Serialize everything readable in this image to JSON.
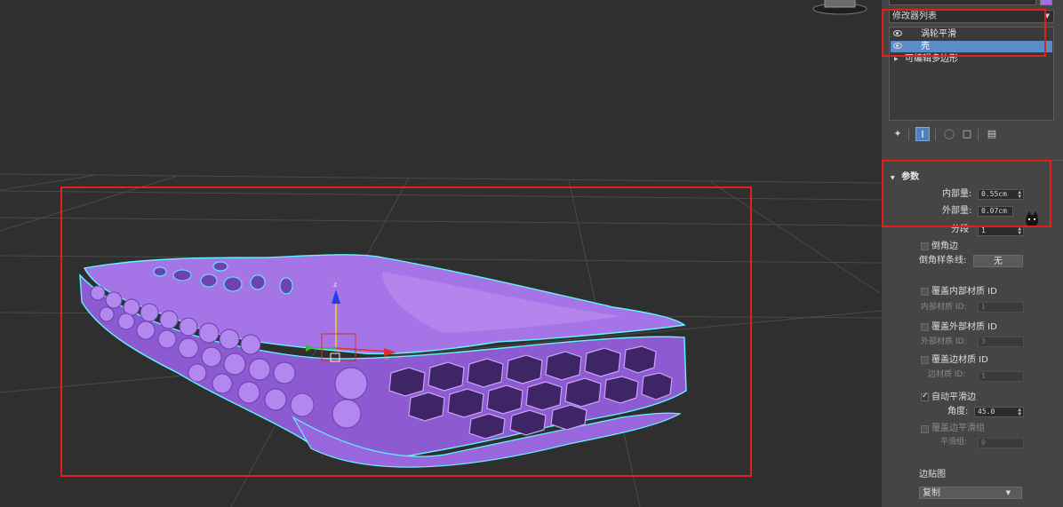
{
  "modifier_list": {
    "label": "修改器列表"
  },
  "stack": {
    "items": [
      {
        "label": "涡轮平滑",
        "visible": true
      },
      {
        "label": "壳",
        "visible": true,
        "selected": true
      },
      {
        "label": "可编辑多边形",
        "visible": false
      }
    ]
  },
  "toolbar": {
    "pin": "pin-stack-icon",
    "show_end_result": "show-end-result-icon",
    "make_unique": "make-unique-icon",
    "remove": "remove-modifier-icon",
    "configure": "configure-sets-icon"
  },
  "params": {
    "title": "参数",
    "inner_amount": {
      "label": "内部量:",
      "value": "0.55cm"
    },
    "outer_amount": {
      "label": "外部量:",
      "value": "0.07cm"
    },
    "segments": {
      "label": "分段",
      "value": "1"
    },
    "bevel_edges": {
      "label": "倒角边",
      "checked": false
    },
    "bevel_spline": {
      "label": "倒角样条线:",
      "value": "无"
    },
    "override_inner_mat": {
      "label": "覆盖内部材质 ID",
      "checked": false
    },
    "inner_mat_id": {
      "label": "内部材质 ID:",
      "value": "1"
    },
    "override_outer_mat": {
      "label": "覆盖外部材质 ID",
      "checked": false
    },
    "outer_mat_id": {
      "label": "外部材质 ID:",
      "value": "3"
    },
    "override_edge_mat": {
      "label": "覆盖边材质 ID",
      "checked": false
    },
    "edge_mat_id": {
      "label": "边材质 ID:",
      "value": "1"
    },
    "auto_smooth": {
      "label": "自动平滑边",
      "checked": true
    },
    "angle": {
      "label": "角度:",
      "value": "45.0"
    },
    "override_smooth_group": {
      "label": "覆盖边平滑组",
      "checked": false
    },
    "smooth_group": {
      "label": "平滑组:",
      "value": "0"
    },
    "edge_mapping": {
      "label": "边贴图",
      "value": "复制"
    }
  },
  "viewport": {
    "gizmo": {
      "z_label": "z",
      "x_label": "x"
    },
    "colors": {
      "object": "#a070e0",
      "selection_outline": "#5ff4ff",
      "highlight": "#e21e1e",
      "grid": "#4a4a4a"
    }
  }
}
